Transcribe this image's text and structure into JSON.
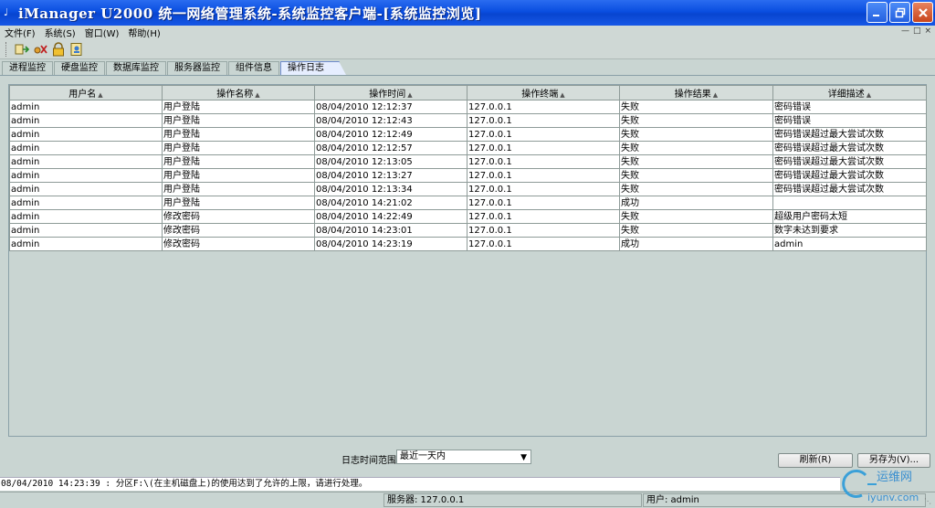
{
  "window": {
    "title": "iManager U2000 统一网络管理系统-系统监控客户端-[系统监控浏览]"
  },
  "menu": [
    "文件(F)",
    "系统(S)",
    "窗口(W)",
    "帮助(H)"
  ],
  "tabs": [
    {
      "label": "进程监控",
      "active": false
    },
    {
      "label": "硬盘监控",
      "active": false
    },
    {
      "label": "数据库监控",
      "active": false
    },
    {
      "label": "服务器监控",
      "active": false
    },
    {
      "label": "组件信息",
      "active": false
    },
    {
      "label": "操作日志",
      "active": true
    }
  ],
  "table": {
    "columns": [
      "用户名",
      "操作名称",
      "操作时间",
      "操作终端",
      "操作结果",
      "详细描述"
    ],
    "rows": [
      [
        "admin",
        "用户登陆",
        "08/04/2010 12:12:37",
        "127.0.0.1",
        "失败",
        "密码错误"
      ],
      [
        "admin",
        "用户登陆",
        "08/04/2010 12:12:43",
        "127.0.0.1",
        "失败",
        "密码错误"
      ],
      [
        "admin",
        "用户登陆",
        "08/04/2010 12:12:49",
        "127.0.0.1",
        "失败",
        "密码错误超过最大尝试次数"
      ],
      [
        "admin",
        "用户登陆",
        "08/04/2010 12:12:57",
        "127.0.0.1",
        "失败",
        "密码错误超过最大尝试次数"
      ],
      [
        "admin",
        "用户登陆",
        "08/04/2010 12:13:05",
        "127.0.0.1",
        "失败",
        "密码错误超过最大尝试次数"
      ],
      [
        "admin",
        "用户登陆",
        "08/04/2010 12:13:27",
        "127.0.0.1",
        "失败",
        "密码错误超过最大尝试次数"
      ],
      [
        "admin",
        "用户登陆",
        "08/04/2010 12:13:34",
        "127.0.0.1",
        "失败",
        "密码错误超过最大尝试次数"
      ],
      [
        "admin",
        "用户登陆",
        "08/04/2010 14:21:02",
        "127.0.0.1",
        "成功",
        ""
      ],
      [
        "admin",
        "修改密码",
        "08/04/2010 14:22:49",
        "127.0.0.1",
        "失败",
        "超级用户密码太短"
      ],
      [
        "admin",
        "修改密码",
        "08/04/2010 14:23:01",
        "127.0.0.1",
        "失败",
        "数字未达到要求"
      ],
      [
        "admin",
        "修改密码",
        "08/04/2010 14:23:19",
        "127.0.0.1",
        "成功",
        "admin"
      ]
    ]
  },
  "filter": {
    "label": "日志时间范围",
    "selected": "最近一天内"
  },
  "buttons": {
    "refresh": "刷新(R)",
    "save_as": "另存为(V)..."
  },
  "status": {
    "message": "08/04/2010 14:23:39 : 分区F:\\(在主机磁盘上)的使用达到了允许的上限，请进行处理。",
    "server": "服务器: 127.0.0.1",
    "user": "用户: admin"
  },
  "watermark": {
    "line1": "运维网",
    "line2": "iyunv.com"
  },
  "colors": {
    "titlebar": "#0a4ee0",
    "window_bg": "#c9d5d2",
    "active_tab": "#e6eeff"
  }
}
